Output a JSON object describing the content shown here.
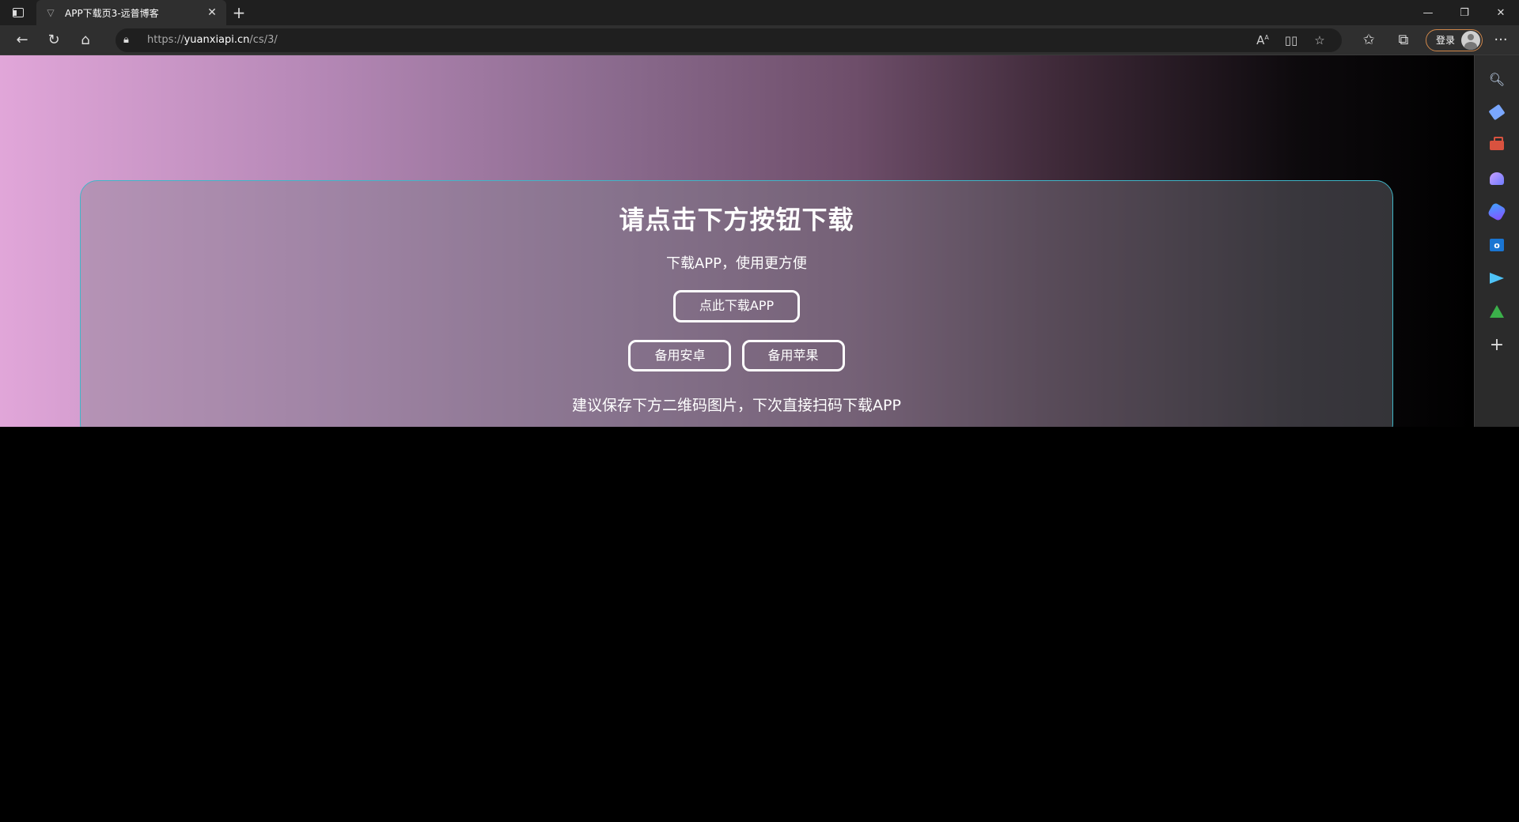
{
  "browser": {
    "tab_title": "APP下载页3-远普博客",
    "url_prefix": "https://",
    "url_domain": "yuanxiapi.cn",
    "url_path": "/cs/3/",
    "login_label": "登录",
    "read_aloud_glyph": "Aᴬ"
  },
  "page": {
    "heading": "请点击下方按钮下载",
    "subtitle": "下载APP，使用更方便",
    "download_button": "点此下载APP",
    "backup_android_button": "备用安卓",
    "backup_apple_button": "备用苹果",
    "hint": "建议保存下方二维码图片，下次直接扫码下载APP"
  },
  "colors": {
    "card_border": "#40b6c8",
    "login_border": "#d0874a",
    "gradient_left": "#e1a6d9",
    "gradient_right": "#000000"
  },
  "sidebar_icons": [
    "search-icon",
    "tag-icon",
    "shopping-bag-icon",
    "people-icon",
    "copilot-icon",
    "outlook-icon",
    "send-icon",
    "tree-icon",
    "add-icon"
  ]
}
